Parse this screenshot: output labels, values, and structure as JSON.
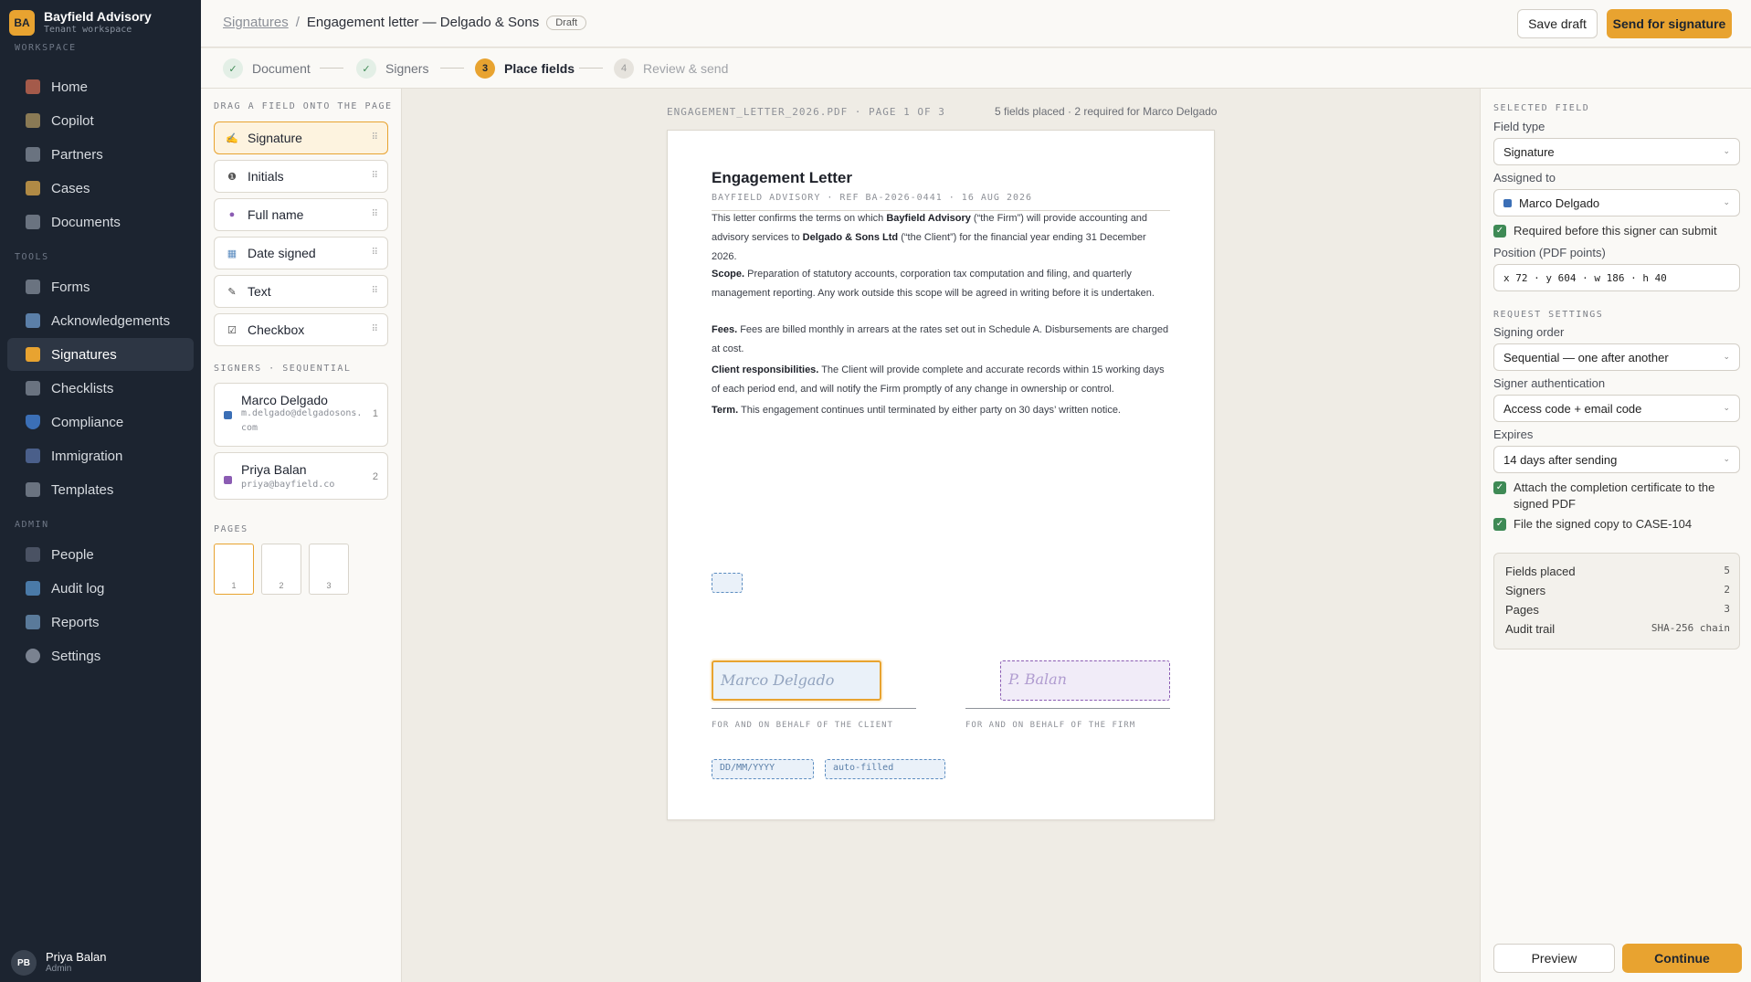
{
  "brand": {
    "initials": "BA",
    "name": "Bayfield Advisory",
    "subtitle": "Tenant workspace"
  },
  "sidebar": {
    "sections": [
      {
        "label": "WORKSPACE",
        "items": [
          {
            "label": "Home",
            "icon": "home-icon"
          },
          {
            "label": "Copilot",
            "icon": "sparkle-icon"
          },
          {
            "label": "Partners",
            "icon": "partners-icon"
          },
          {
            "label": "Cases",
            "icon": "folder-icon"
          },
          {
            "label": "Documents",
            "icon": "document-icon"
          }
        ]
      },
      {
        "label": "TOOLS",
        "items": [
          {
            "label": "Forms",
            "icon": "form-icon"
          },
          {
            "label": "Acknowledgements",
            "icon": "pen-icon"
          },
          {
            "label": "Signatures",
            "icon": "signature-icon",
            "active": true
          },
          {
            "label": "Checklists",
            "icon": "checklist-icon"
          },
          {
            "label": "Compliance",
            "icon": "shield-icon"
          },
          {
            "label": "Immigration",
            "icon": "passport-icon"
          },
          {
            "label": "Templates",
            "icon": "template-icon"
          }
        ]
      },
      {
        "label": "ADMIN",
        "items": [
          {
            "label": "People",
            "icon": "people-icon"
          },
          {
            "label": "Audit log",
            "icon": "audit-icon"
          },
          {
            "label": "Reports",
            "icon": "reports-icon"
          },
          {
            "label": "Settings",
            "icon": "gear-icon"
          }
        ]
      }
    ],
    "user": {
      "initials": "PB",
      "name": "Priya Balan",
      "role": "Admin"
    }
  },
  "topbar": {
    "breadcrumb_link": "Signatures",
    "separator": "/",
    "title": "Engagement letter — Delgado & Sons",
    "status": "Draft",
    "save_label": "Save draft",
    "send_label": "Send for signature"
  },
  "stepper": [
    {
      "num": "✓",
      "label": "Document",
      "state": "done"
    },
    {
      "num": "✓",
      "label": "Signers",
      "state": "done"
    },
    {
      "num": "3",
      "label": "Place fields",
      "state": "current"
    },
    {
      "num": "4",
      "label": "Review & send",
      "state": "todo"
    }
  ],
  "left_panel": {
    "fields_label": "DRAG A FIELD ONTO THE PAGE",
    "fields": [
      {
        "label": "Signature",
        "icon": "signature-icon"
      },
      {
        "label": "Initials",
        "icon": "initials-icon"
      },
      {
        "label": "Full name",
        "icon": "person-icon"
      },
      {
        "label": "Date signed",
        "icon": "calendar-icon"
      },
      {
        "label": "Text",
        "icon": "text-icon"
      },
      {
        "label": "Checkbox",
        "icon": "checkbox-icon"
      }
    ],
    "grip": "⠿",
    "signers_label": "SIGNERS · SEQUENTIAL",
    "signers": [
      {
        "name": "Marco Delgado",
        "email_line1": "m.delgado@delgadosons.",
        "email_line2": "com",
        "order": "1",
        "color": "#3b6fb6"
      },
      {
        "name": "Priya Balan",
        "email_line1": "priya@bayfield.co",
        "email_line2": "",
        "order": "2",
        "color": "#8b5cb3"
      }
    ],
    "pages_label": "PAGES",
    "pages": [
      "1",
      "2",
      "3"
    ]
  },
  "canvas": {
    "file_meta": "ENGAGEMENT_LETTER_2026.PDF · PAGE 1 OF 3",
    "field_summary": "5 fields placed · 2 required for Marco Delgado",
    "doc": {
      "title": "Engagement Letter",
      "ref": "BAYFIELD ADVISORY · REF BA-2026-0441 · 16 AUG 2026",
      "intro": {
        "pre": "This letter confirms the terms on which ",
        "b1": "Bayfield Advisory",
        "mid": " (“the Firm”) will provide accounting and advisory services to ",
        "b2": "Delgado & Sons Ltd",
        "post": " (“the Client”) for the financial year ending 31 December 2026."
      },
      "scope": {
        "head": "Scope.",
        "text": " Preparation of statutory accounts, corporation tax computation and filing, and quarterly management reporting. Any work outside this scope will be agreed in writing before it is undertaken."
      },
      "fees": {
        "head": "Fees.",
        "text": " Fees are billed monthly in arrears at the rates set out in Schedule A. Disbursements are charged at cost."
      },
      "client": {
        "head": "Client responsibilities.",
        "text": " The Client will provide complete and accurate records within 15 working days of each period end, and will notify the Firm promptly of any change in ownership or control."
      },
      "term": {
        "head": "Term.",
        "text": " This engagement continues until terminated by either party on 30 days’ written notice."
      },
      "sig_client": "Marco Delgado",
      "sig_firm": "P. Balan",
      "caption_client": "FOR AND ON BEHALF OF THE CLIENT",
      "caption_firm": "FOR AND ON BEHALF OF THE FIRM",
      "date_placeholder": "DD/MM/YYYY",
      "auto_filled": "auto-filled"
    }
  },
  "right_panel": {
    "selected_label": "SELECTED FIELD",
    "field_type_label": "Field type",
    "field_type": "Signature",
    "assigned_label": "Assigned to",
    "assigned": "Marco Delgado",
    "assigned_color": "#3b6fb6",
    "required_label": "Required before this signer can submit",
    "position_label": "Position (PDF points)",
    "position": "x 72 · y 604 · w 186 · h 40",
    "request_label": "REQUEST SETTINGS",
    "order_label": "Signing order",
    "order": "Sequential — one after another",
    "auth_label": "Signer authentication",
    "auth": "Access code + email code",
    "expires_label": "Expires",
    "expires": "14 days after sending",
    "attach_label": "Attach the completion certificate to the signed PDF",
    "file_label": "File the signed copy to CASE-104",
    "summary": [
      {
        "label": "Fields placed",
        "value": "5"
      },
      {
        "label": "Signers",
        "value": "2"
      },
      {
        "label": "Pages",
        "value": "3"
      },
      {
        "label": "Audit trail",
        "value": "SHA-256 chain"
      }
    ],
    "preview_label": "Preview",
    "continue_label": "Continue"
  },
  "colors": {
    "accent": "#e8a330",
    "sidebar_bg": "#1c2430",
    "success": "#3e8a55",
    "field_blue": "#5b8cc0",
    "field_purple": "#8b5cb3"
  }
}
